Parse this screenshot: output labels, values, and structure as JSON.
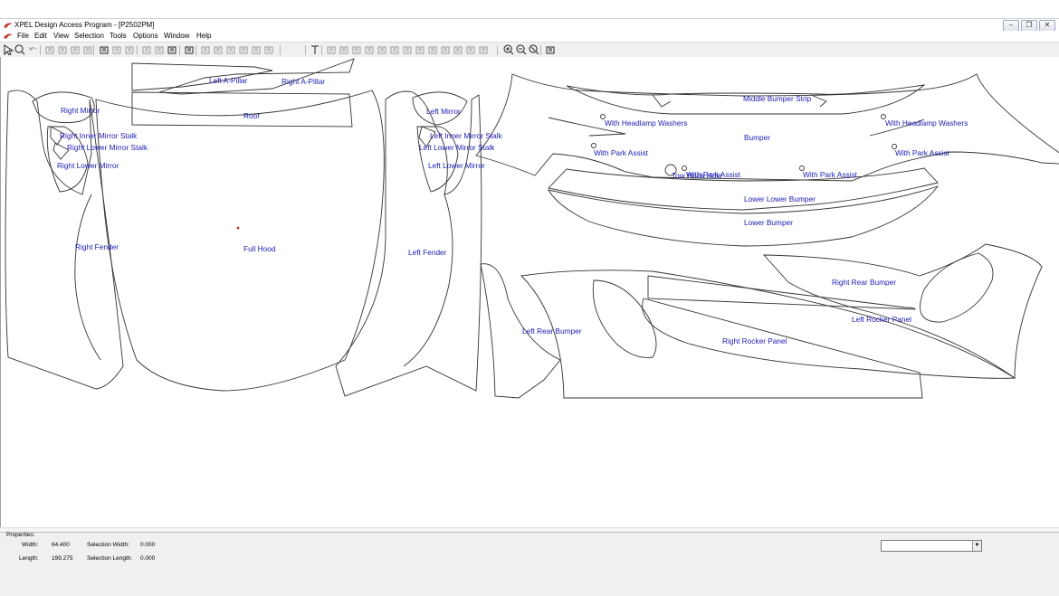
{
  "window": {
    "title": "XPEL Design Access Program - [P2502PM]",
    "controls": {
      "minimize": "‒",
      "restore": "❐",
      "close": "✕"
    }
  },
  "menu": [
    "File",
    "Edit",
    "View",
    "Selection",
    "Tools",
    "Options",
    "Window",
    "Help"
  ],
  "toolbar_icons": [
    "select-arrow-icon",
    "zoom-icon",
    "undo-icon",
    "cut-icon",
    "copy-icon",
    "paste-icon",
    "delete-icon",
    "print-icon",
    "print-preview-icon",
    "car-icon",
    "rectangle-icon",
    "mail-icon",
    "export-icon",
    "plot-icon",
    "align-left-icon",
    "align-center-icon",
    "align-right-icon",
    "align-top-icon",
    "align-middle-icon",
    "align-bottom-icon",
    "text-tool-icon",
    "node-edit-icon",
    "pen-icon",
    "curve-icon",
    "line-icon",
    "move-icon",
    "scissors-icon",
    "weld-icon",
    "mirror-icon",
    "block-icon",
    "flip-icon",
    "rotate-icon",
    "nest-icon",
    "stack-icon",
    "zoom-in-icon",
    "zoom-out-icon",
    "zoom-fit-icon",
    "cutter-icon"
  ],
  "labels": {
    "left_a_pillar": "Left A-Pillar",
    "right_a_pillar": "Right A-Pillar",
    "roof": "Roof",
    "right_mirror": "Right Mirror",
    "right_inner_mirror_stalk": "Right Inner Mirror Stalk",
    "right_lower_mirror_stalk": "Right Lower Mirror Stalk",
    "right_lower_mirror": "Right Lower Mirror",
    "left_mirror": "Left Mirror",
    "left_inner_mirror_stalk": "Left Inner Mirror Stalk",
    "left_lower_mirror_stalk": "Left Lower Mirror Stalk",
    "left_lower_mirror": "Left Lower Mirror",
    "right_fender": "Right Fender",
    "full_hood": "Full Hood",
    "left_fender": "Left Fender",
    "middle_bumper_strip": "Middle Bumper Strip",
    "with_headlamp_washers_1": "With Headlamp Washers",
    "with_headlamp_washers_2": "With Headlamp Washers",
    "bumper": "Bumper",
    "with_park_assist_1": "With Park Assist",
    "with_park_assist_2": "With Park Assist",
    "with_park_assist_3": "With Park Assist",
    "with_park_assist_4": "With Park Assist",
    "tow_hook_hole": "Tow Hook Hole",
    "lower_lower_bumper": "Lower Lower Bumper",
    "lower_bumper": "Lower Bumper",
    "right_rear_bumper": "Right Rear Bumper",
    "left_rocker_panel": "Left Rocker Panel",
    "left_rear_bumper": "Left Rear Bumper",
    "right_rocker_panel": "Right Rocker Panel"
  },
  "properties": {
    "heading": "Properties:",
    "width_label": "Width:",
    "width_value": "64.400",
    "length_label": "Length:",
    "length_value": "199.275",
    "sel_width_label": "Selection Width:",
    "sel_width_value": "0.000",
    "sel_length_label": "Selection Length:",
    "sel_length_value": "0.000",
    "dropdown_value": ""
  },
  "colors": {
    "label_text": "#1a1ab4",
    "outline": "#333333",
    "toolbar_bg": "#f0f0f0",
    "panel_bg": "#f0f0f0",
    "app_icon": "#c0392b"
  }
}
